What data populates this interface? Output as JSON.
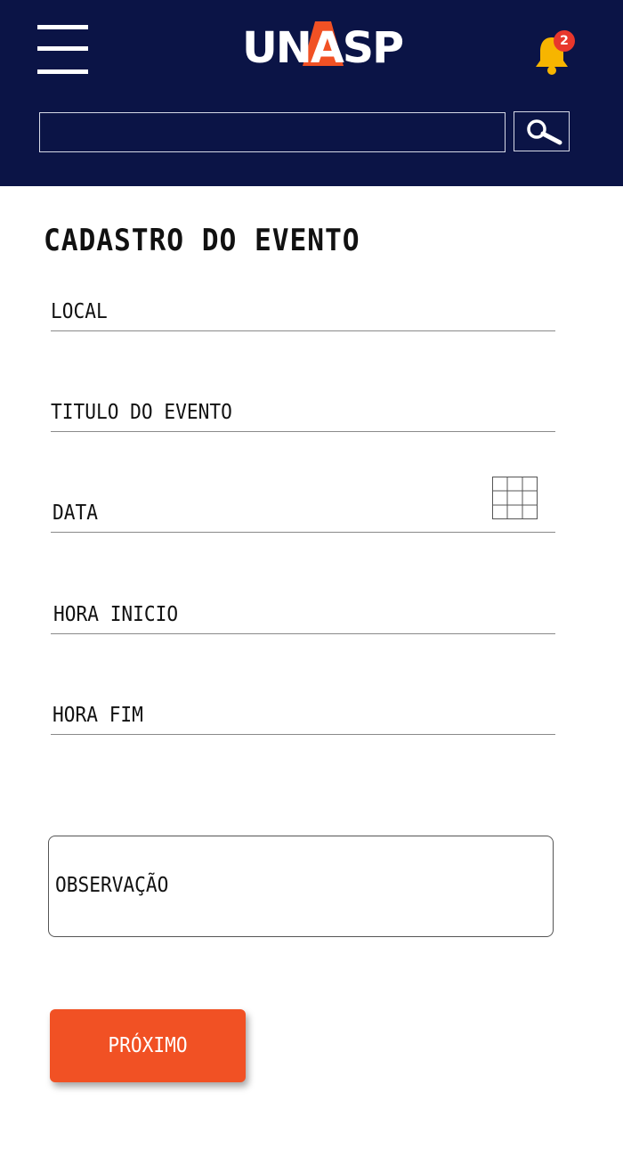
{
  "header": {
    "menu_icon": "hamburger-menu-icon",
    "logo_text": "UNASP",
    "notifications": {
      "icon": "bell-icon",
      "count": "2"
    },
    "search": {
      "value": "",
      "placeholder": "",
      "button_icon": "magnifier-icon"
    }
  },
  "form": {
    "title": "CADASTRO DO EVENTO",
    "fields": [
      {
        "label": "LOCAL"
      },
      {
        "label": "TITULO DO EVENTO"
      },
      {
        "label": "DATA",
        "icon": "calendar-grid-icon"
      },
      {
        "label": "HORA INICIO"
      },
      {
        "label": "HORA FIM"
      }
    ],
    "observation_label": "OBSERVAÇÃO",
    "next_button": "PRÓXIMO"
  },
  "colors": {
    "header_bg": "#0b1446",
    "accent": "#f15124",
    "logo_a": "#f15124",
    "bell": "#f7b500",
    "badge": "#e8372c"
  }
}
